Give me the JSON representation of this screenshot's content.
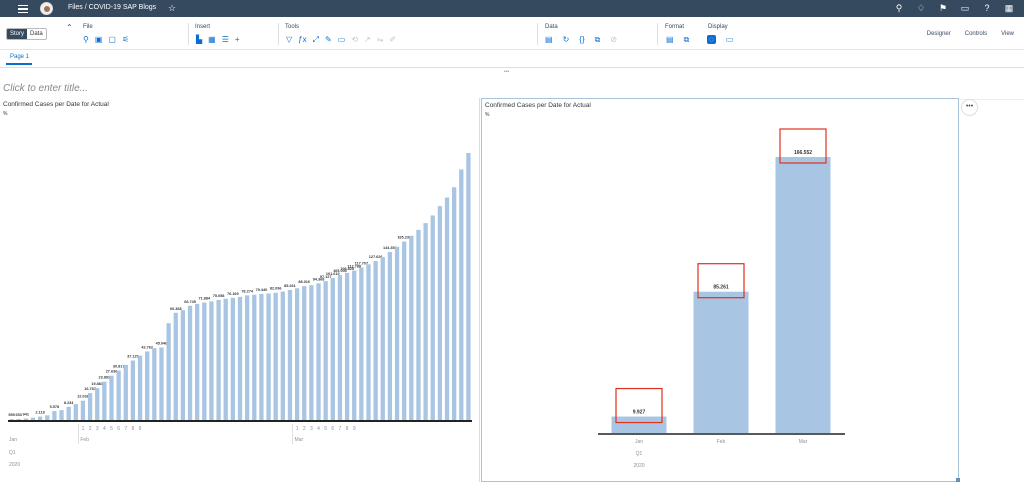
{
  "shell": {
    "breadcrumb": "Files  /  COVID-19 SAP Blogs",
    "icons": [
      "search-icon",
      "lightbulb-icon",
      "notifications-icon",
      "feedback-icon",
      "help-icon",
      "apps-icon"
    ]
  },
  "toolbar": {
    "story_label": "Story",
    "data_label": "Data",
    "groups": [
      {
        "label": "File",
        "icons": [
          "⚲",
          "▣",
          "▢",
          "⚟"
        ]
      },
      {
        "label": "Insert",
        "icons": [
          "▙",
          "▦",
          "☰",
          "+"
        ]
      },
      {
        "label": "Tools",
        "icons": [
          "▽",
          "ƒx",
          "⤢",
          "✎",
          "▭",
          "⟲",
          "↗",
          "⇋",
          "✐"
        ]
      },
      {
        "label": "Data",
        "icons": [
          "▤",
          "↻",
          "{}",
          "⧉",
          "⊘"
        ]
      },
      {
        "label": "Format",
        "icons": [
          "▤",
          "⧉"
        ]
      },
      {
        "label": "Display",
        "icons": [
          "◌",
          "▭"
        ]
      }
    ],
    "right_links": [
      "Designer",
      "Controls",
      "View"
    ]
  },
  "page_tab": "Page 1",
  "title_placeholder": "Click to enter title...",
  "panels": [
    {
      "title": "Confirmed Cases per Date for Actual",
      "mark": "%"
    },
    {
      "title": "Confirmed Cases per Date for Actual",
      "mark": "%"
    }
  ],
  "chart_data": [
    {
      "type": "bar",
      "title": "Confirmed Cases per Date for Actual",
      "bar_color": "#a8c5e3",
      "values": [
        555,
        653,
        941,
        1438,
        2118,
        2927,
        5578,
        6166,
        8234,
        9927,
        12038,
        16787,
        19881,
        23892,
        27636,
        30817,
        34391,
        37120,
        40150,
        42762,
        44802,
        45221,
        60368,
        66885,
        68500,
        71224,
        72436,
        73258,
        73964,
        74876,
        75638,
        76196,
        76815,
        77743,
        78166,
        78600,
        78927,
        79400,
        80130,
        81100,
        82166,
        83500,
        84100,
        85261,
        86600,
        88585,
        90400,
        91800,
        93200,
        95124,
        97100,
        99200,
        101584,
        104800,
        108000,
        111300,
        114902,
        118600,
        122800,
        127605,
        133400,
        138800,
        145166,
        156300,
        166552
      ],
      "data_labels": {
        "0": "555",
        "1": "653",
        "2": "941",
        "4": "2.118",
        "6": "5.578",
        "8": "8.234",
        "10": "12.038",
        "11": "16.787",
        "12": "19.881",
        "13": "23.892",
        "14": "27.636",
        "15": "30.817",
        "17": "37.120",
        "19": "42.762",
        "21": "45.046",
        "23": "60.368",
        "25": "66.745",
        "27": "71.884",
        "29": "75.058",
        "31": "76.169",
        "33": "78.274",
        "35": "79.440",
        "37": "82.096",
        "39": "85.261",
        "41": "88.016",
        "43": "94.368",
        "44": "97.127",
        "45": "101.610",
        "46": "105.005",
        "47": "109.825",
        "48": "112.788",
        "49": "117.707",
        "51": "127.626",
        "53": "144.352",
        "55": "165.236"
      },
      "month_labels": [
        {
          "text": "Jan",
          "at": 0
        },
        {
          "text": "Feb",
          "at": 10
        },
        {
          "text": "Mar",
          "at": 40
        }
      ],
      "day_labels": [
        "1",
        "2",
        "3",
        "4",
        "5",
        "6",
        "7",
        "8",
        "9",
        "1",
        "2",
        "3",
        "4",
        "5",
        "6",
        "7",
        "8",
        "9"
      ],
      "quarter": "Q1",
      "year": "2020"
    },
    {
      "type": "bar",
      "title": "Confirmed Cases per Date for Actual",
      "bar_color": "#a8c5e3",
      "categories": [
        "Jan",
        "Feb",
        "Mar"
      ],
      "values": [
        9927,
        85261,
        166552
      ],
      "value_labels": [
        "9.927",
        "85.261",
        "166.552"
      ],
      "highlight_color": "#e0301e",
      "quarter": "Q1",
      "year": "2020"
    }
  ]
}
